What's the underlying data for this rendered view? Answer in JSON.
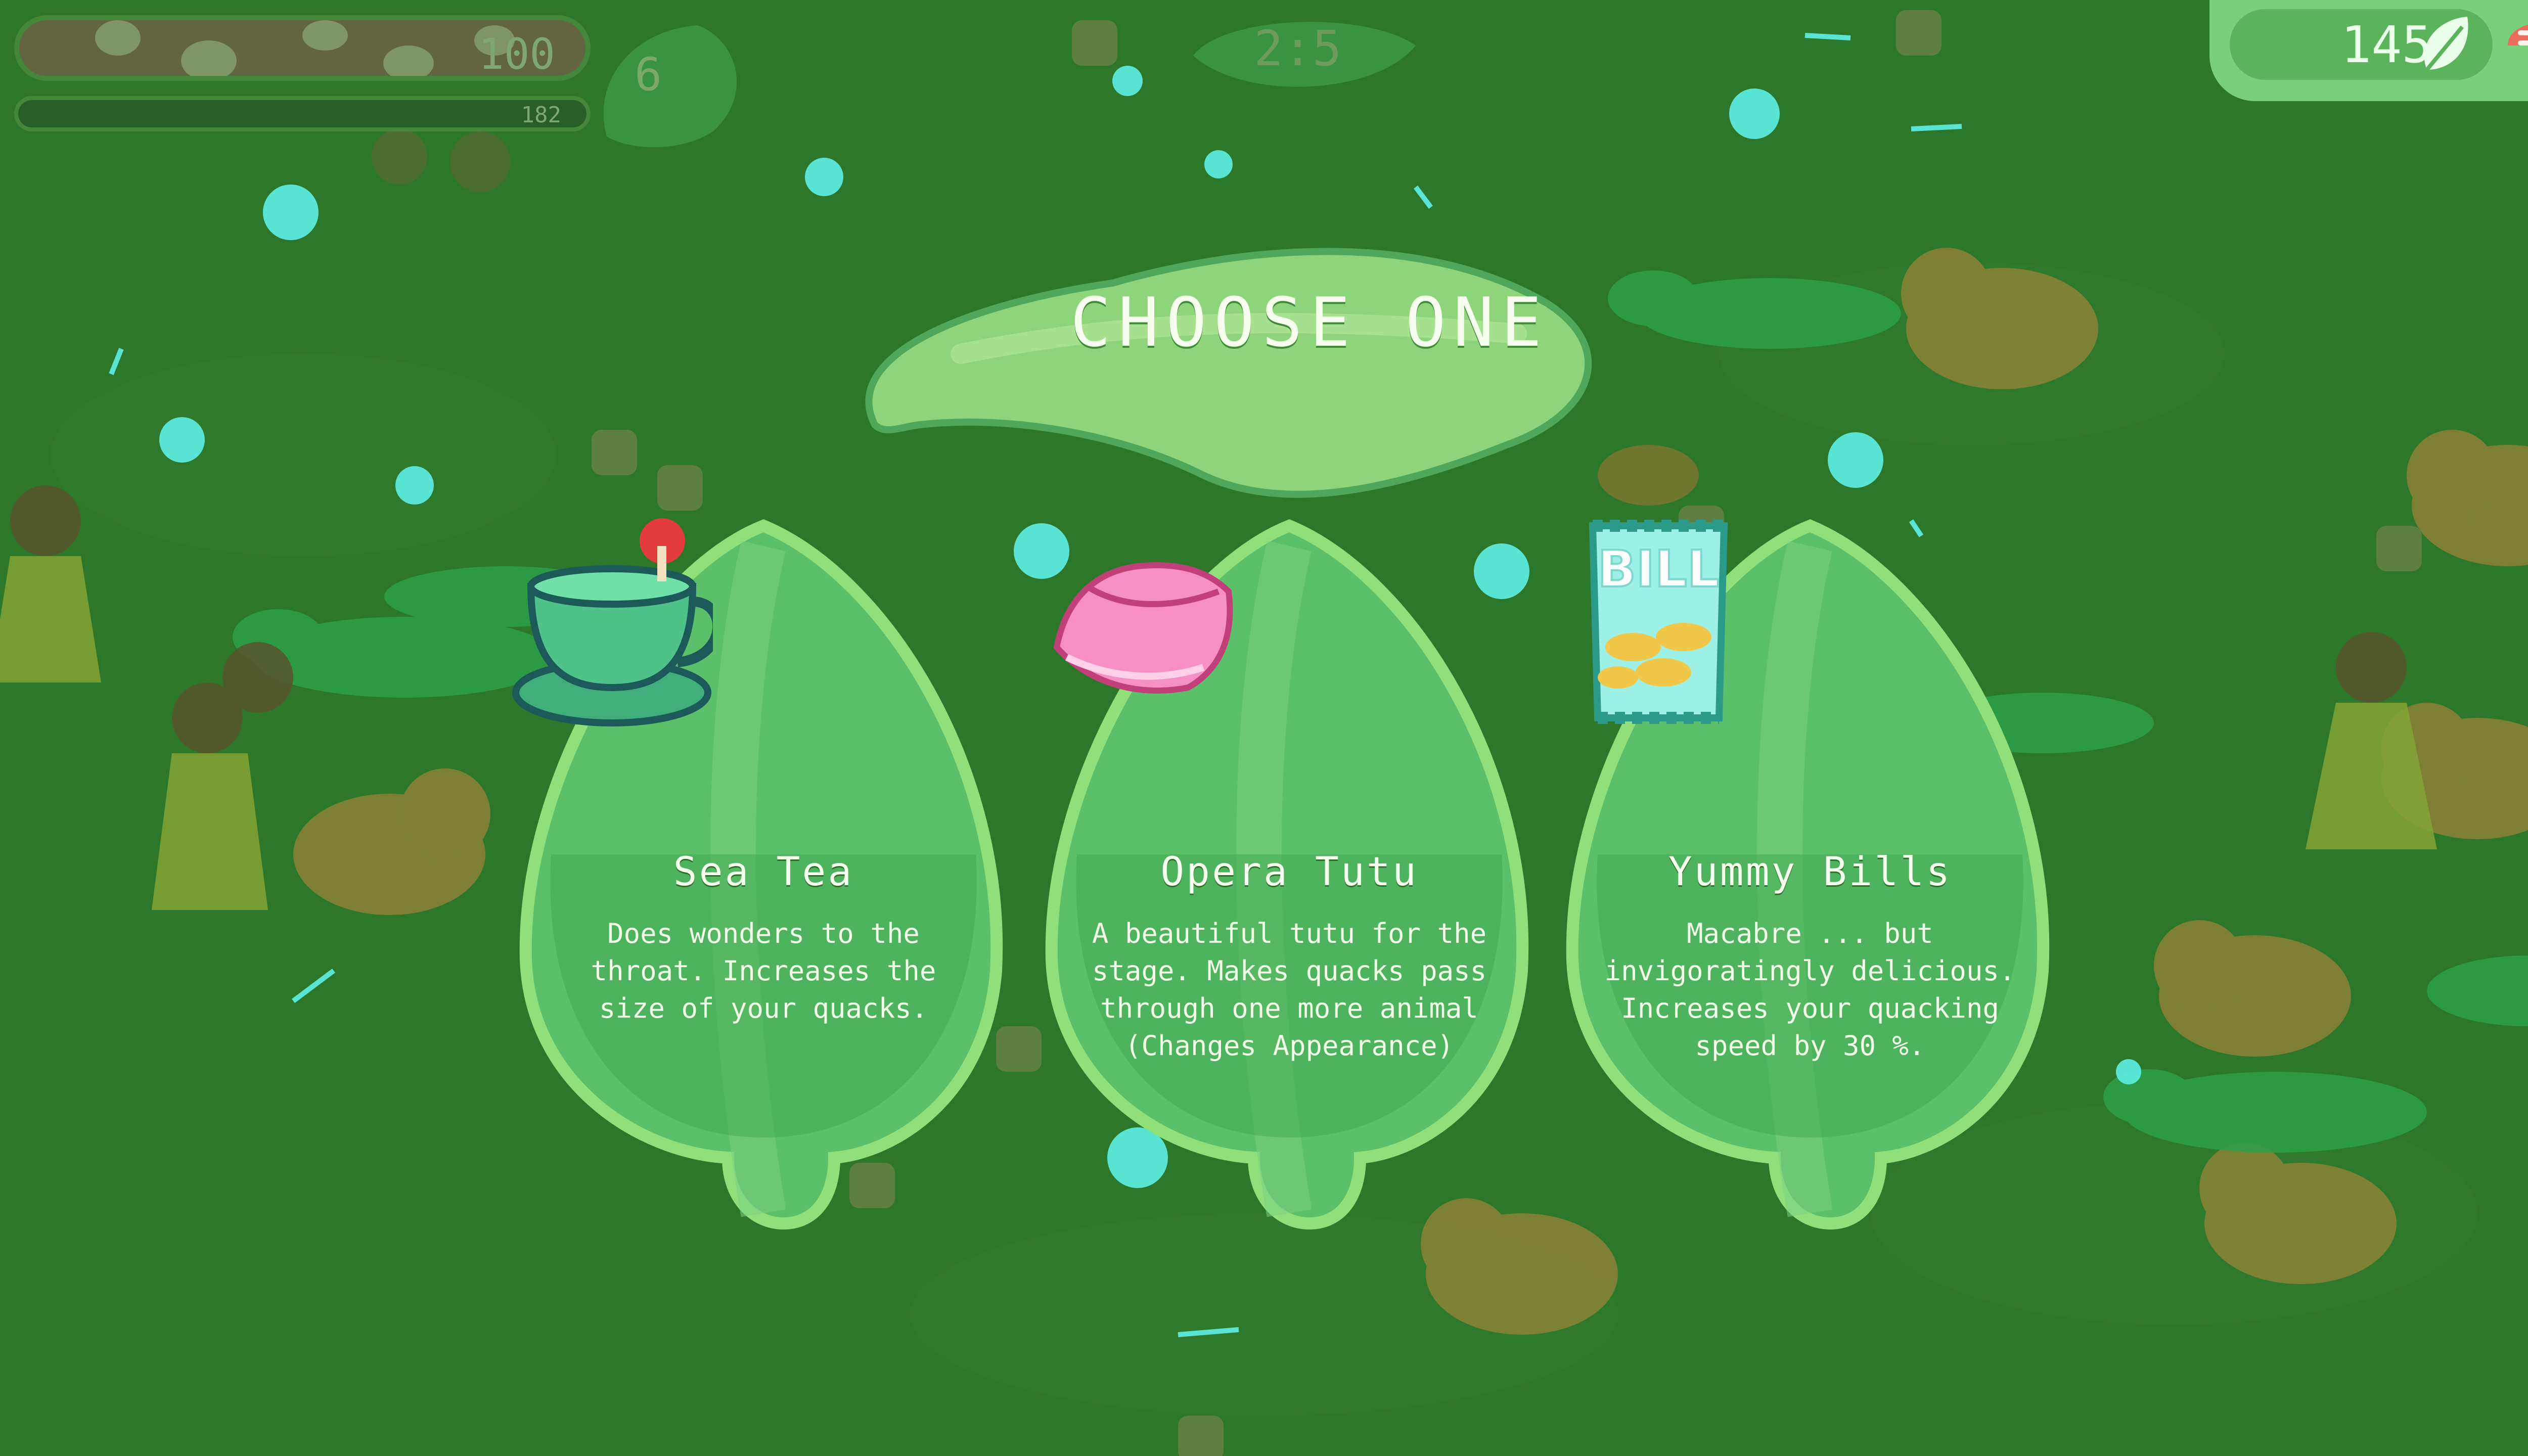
{
  "hud": {
    "health_value": "100",
    "xp_value": "182",
    "level": "6",
    "timer": "2:5",
    "currency": "145",
    "currency_icon": "leaf-icon",
    "menu_icon": "mushroom-menu-icon"
  },
  "dialog": {
    "title": "CHOOSE ONE"
  },
  "choices": [
    {
      "name": "Sea Tea",
      "description": "Does wonders to the throat. Increases the size of your quacks.",
      "icon": "teacup-icon"
    },
    {
      "name": "Opera Tutu",
      "description": "A beautiful tutu for the stage. Makes quacks pass through one more animal (Changes Appearance)",
      "icon": "tutu-icon"
    },
    {
      "name": "Yummy Bills",
      "description": "Macabre ... but invigoratingly delicious. Increases your quacking speed by 30 %.",
      "icon": "chip-bag-icon",
      "bag_label": "BILL"
    }
  ],
  "colors": {
    "grass": "#2f7a2c",
    "card_fill": "#5cbf6a",
    "card_border": "#8fe07a",
    "title_leaf": "#8ed47a",
    "accent_cyan": "#5ff0e6"
  }
}
